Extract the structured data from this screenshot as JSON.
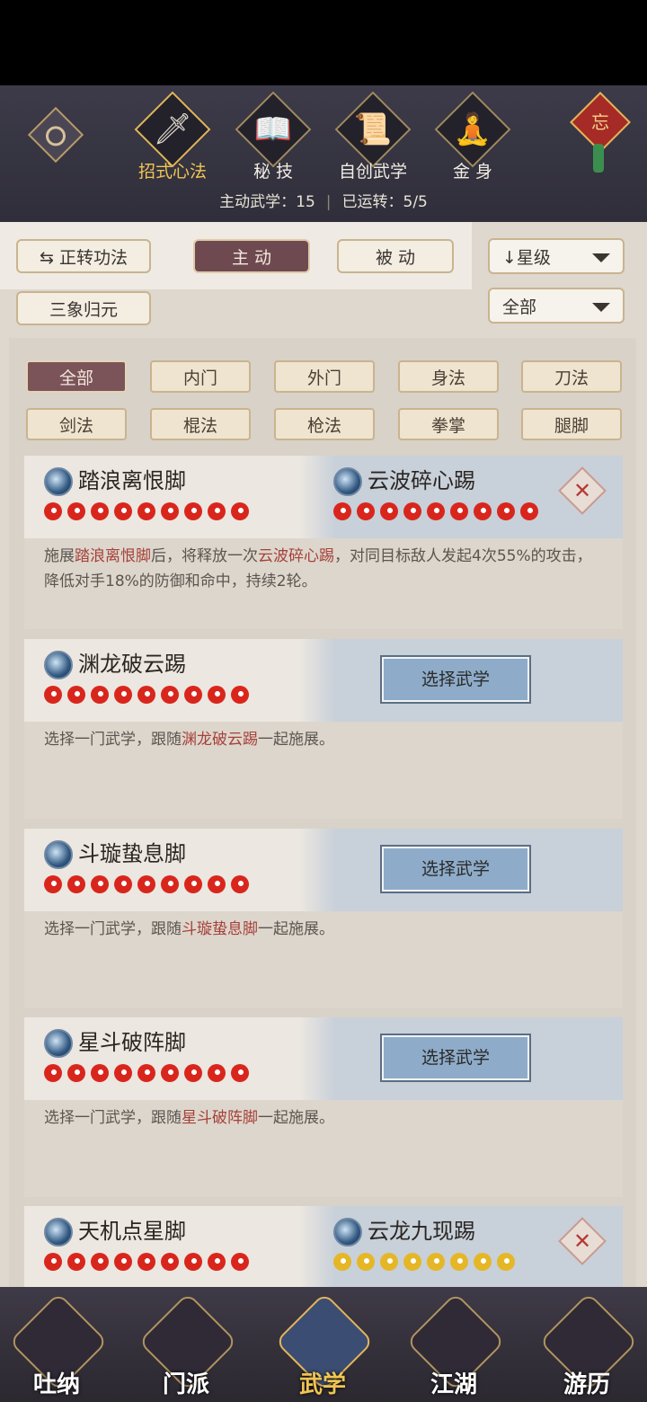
{
  "header": {
    "tabs": [
      {
        "label": "招式心法",
        "icon": "sword-icon",
        "active": true
      },
      {
        "label": "秘 技",
        "icon": "book-icon",
        "active": false
      },
      {
        "label": "自创武学",
        "icon": "scroll-icon",
        "active": false
      },
      {
        "label": "金 身",
        "icon": "meditation-icon",
        "active": false
      }
    ],
    "seal_char": "忘",
    "stats": {
      "active_label": "主动武学：15",
      "running_label": "已运转：5/5"
    }
  },
  "toolbar": {
    "forward": "正转功法",
    "active": "主 动",
    "passive": "被 动",
    "sort": "星级",
    "merge": "三象归元",
    "filter": "全部"
  },
  "categories": [
    "全部",
    "内门",
    "外门",
    "身法",
    "刀法",
    "剑法",
    "棍法",
    "枪法",
    "拳掌",
    "腿脚"
  ],
  "cards": [
    {
      "name": "踏浪离恨脚",
      "flames": 9,
      "partner": {
        "name": "云波碎心踢",
        "flames": 9,
        "gold": false
      },
      "desc_parts": [
        "施展",
        "踏浪离恨脚",
        "后，将释放一次",
        "云波碎心踢",
        "，对同目标敌人发起4次55%的攻击，降低对手18%的防御和命中，持续2轮。"
      ]
    },
    {
      "name": "渊龙破云踢",
      "flames": 9,
      "button": "选择武学",
      "desc_parts": [
        "选择一门武学，跟随",
        "渊龙破云踢",
        "一起施展。"
      ]
    },
    {
      "name": "斗璇蛰息脚",
      "flames": 9,
      "button": "选择武学",
      "desc_parts": [
        "选择一门武学，跟随",
        "斗璇蛰息脚",
        "一起施展。"
      ]
    },
    {
      "name": "星斗破阵脚",
      "flames": 9,
      "button": "选择武学",
      "desc_parts": [
        "选择一门武学，跟随",
        "星斗破阵脚",
        "一起施展。"
      ]
    },
    {
      "name": "天机点星脚",
      "flames": 9,
      "partner": {
        "name": "云龙九现踢",
        "flames": 8,
        "gold": true
      }
    }
  ],
  "bottom_nav": [
    {
      "label": "吐纳",
      "active": false
    },
    {
      "label": "门派",
      "active": false
    },
    {
      "label": "武学",
      "active": true
    },
    {
      "label": "江湖",
      "active": false
    },
    {
      "label": "游历",
      "active": false
    }
  ]
}
